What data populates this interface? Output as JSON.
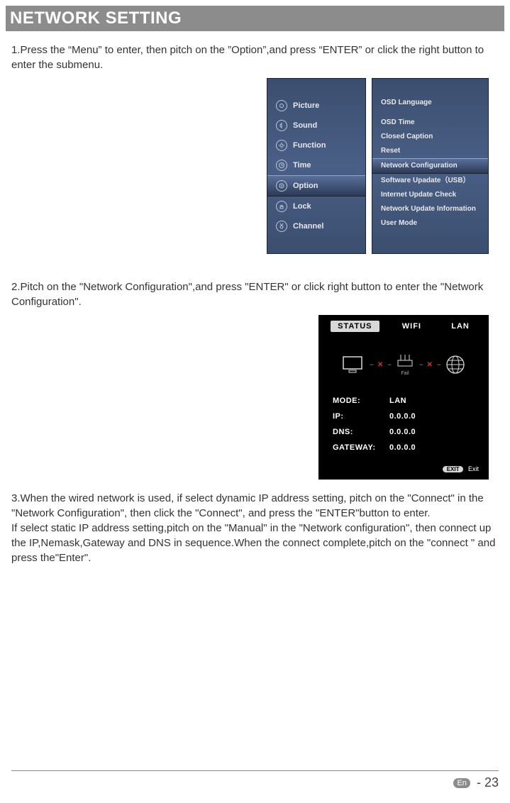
{
  "header": "NETWORK SETTING",
  "step1": "1.Press the “Menu” to enter, then pitch on the ”Option”,and press “ENTER” or click the right button to enter the submenu.",
  "menu": {
    "items": [
      {
        "label": "Picture",
        "icon": "picture-icon",
        "selected": false
      },
      {
        "label": "Sound",
        "icon": "sound-icon",
        "selected": false
      },
      {
        "label": "Function",
        "icon": "function-icon",
        "selected": false
      },
      {
        "label": "Time",
        "icon": "time-icon",
        "selected": false
      },
      {
        "label": "Option",
        "icon": "option-icon",
        "selected": true
      },
      {
        "label": "Lock",
        "icon": "lock-icon",
        "selected": false
      },
      {
        "label": "Channel",
        "icon": "channel-icon",
        "selected": false
      }
    ]
  },
  "options": {
    "items": [
      {
        "label": "OSD Language",
        "selected": false
      },
      {
        "label": "OSD Time",
        "selected": false
      },
      {
        "label": "Closed Caption",
        "selected": false
      },
      {
        "label": "Reset",
        "selected": false
      },
      {
        "label": "Network Configuration",
        "selected": true
      },
      {
        "label": "Software Upadate（USB）",
        "selected": false
      },
      {
        "label": "Internet Update Check",
        "selected": false
      },
      {
        "label": "Network Update Information",
        "selected": false
      },
      {
        "label": "User Mode",
        "selected": false
      }
    ]
  },
  "step2": "2.Pitch on the \"Network Configuration\",and press \"ENTER\" or click right button to enter the \"Network Configuration\".",
  "status": {
    "tabs": {
      "status": "STATUS",
      "wifi": "WIFI",
      "lan": "LAN"
    },
    "fail_label": "Fail",
    "fields": {
      "mode": {
        "label": "MODE:",
        "value": "LAN"
      },
      "ip": {
        "label": "IP:",
        "value": "0.0.0.0"
      },
      "dns": {
        "label": "DNS:",
        "value": "0.0.0.0"
      },
      "gateway": {
        "label": "GATEWAY:",
        "value": "0.0.0.0"
      }
    },
    "exit_badge": "EXIT",
    "exit_label": "Exit"
  },
  "step3": "3.When the wired network is used, if select dynamic IP address setting, pitch on the \"Connect\" in the \"Network Configuration\", then  click the \"Connect\", and press the \"ENTER\"button to enter.\nIf select static IP address setting,pitch on the \"Manual\" in the \"Network configuration\", then connect up the IP,Nemask,Gateway and DNS in sequence.When the connect complete,pitch on the \"connect \" and press the\"Enter\".",
  "footer": {
    "lang": "En",
    "sep": "-",
    "page": "23"
  }
}
